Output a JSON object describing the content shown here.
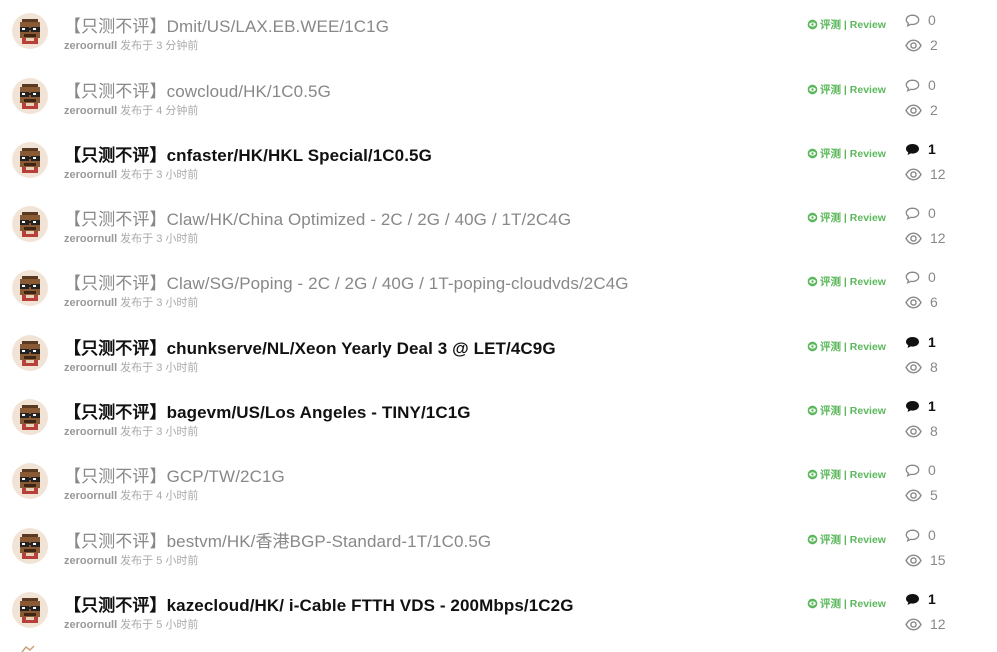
{
  "colors": {
    "review": "#5cb85c",
    "muted_title": "#888888",
    "bold_title": "#111111",
    "meta": "#aaaaaa"
  },
  "review_label": "评测 | Review",
  "topics": [
    {
      "title": "【只测不评】Dmit/US/LAX.EB.WEE/1C1G",
      "author": "zeroornull",
      "time": "发布于 3 分钟前",
      "comments": "0",
      "views": "2",
      "bold": false
    },
    {
      "title": "【只测不评】cowcloud/HK/1C0.5G",
      "author": "zeroornull",
      "time": "发布于 4 分钟前",
      "comments": "0",
      "views": "2",
      "bold": false
    },
    {
      "title": "【只测不评】cnfaster/HK/HKL Special/1C0.5G",
      "author": "zeroornull",
      "time": "发布于 3 小时前",
      "comments": "1",
      "views": "12",
      "bold": true
    },
    {
      "title": "【只测不评】Claw/HK/China Optimized - 2C / 2G / 40G / 1T/2C4G",
      "author": "zeroornull",
      "time": "发布于 3 小时前",
      "comments": "0",
      "views": "12",
      "bold": false
    },
    {
      "title": "【只测不评】Claw/SG/Poping - 2C / 2G / 40G / 1T-poping-cloudvds/2C4G",
      "author": "zeroornull",
      "time": "发布于 3 小时前",
      "comments": "0",
      "views": "6",
      "bold": false
    },
    {
      "title": "【只测不评】chunkserve/NL/Xeon Yearly Deal 3 @ LET/4C9G",
      "author": "zeroornull",
      "time": "发布于 3 小时前",
      "comments": "1",
      "views": "8",
      "bold": true
    },
    {
      "title": "【只测不评】bagevm/US/Los Angeles - TINY/1C1G",
      "author": "zeroornull",
      "time": "发布于 3 小时前",
      "comments": "1",
      "views": "8",
      "bold": true
    },
    {
      "title": "【只测不评】GCP/TW/2C1G",
      "author": "zeroornull",
      "time": "发布于 4 小时前",
      "comments": "0",
      "views": "5",
      "bold": false
    },
    {
      "title": "【只测不评】bestvm/HK/香港BGP-Standard-1T/1C0.5G",
      "author": "zeroornull",
      "time": "发布于 5 小时前",
      "comments": "0",
      "views": "15",
      "bold": false
    },
    {
      "title": "【只测不评】kazecloud/HK/ i-Cable FTTH VDS - 200Mbps/1C2G",
      "author": "zeroornull",
      "time": "发布于 5 小时前",
      "comments": "1",
      "views": "12",
      "bold": true
    }
  ]
}
